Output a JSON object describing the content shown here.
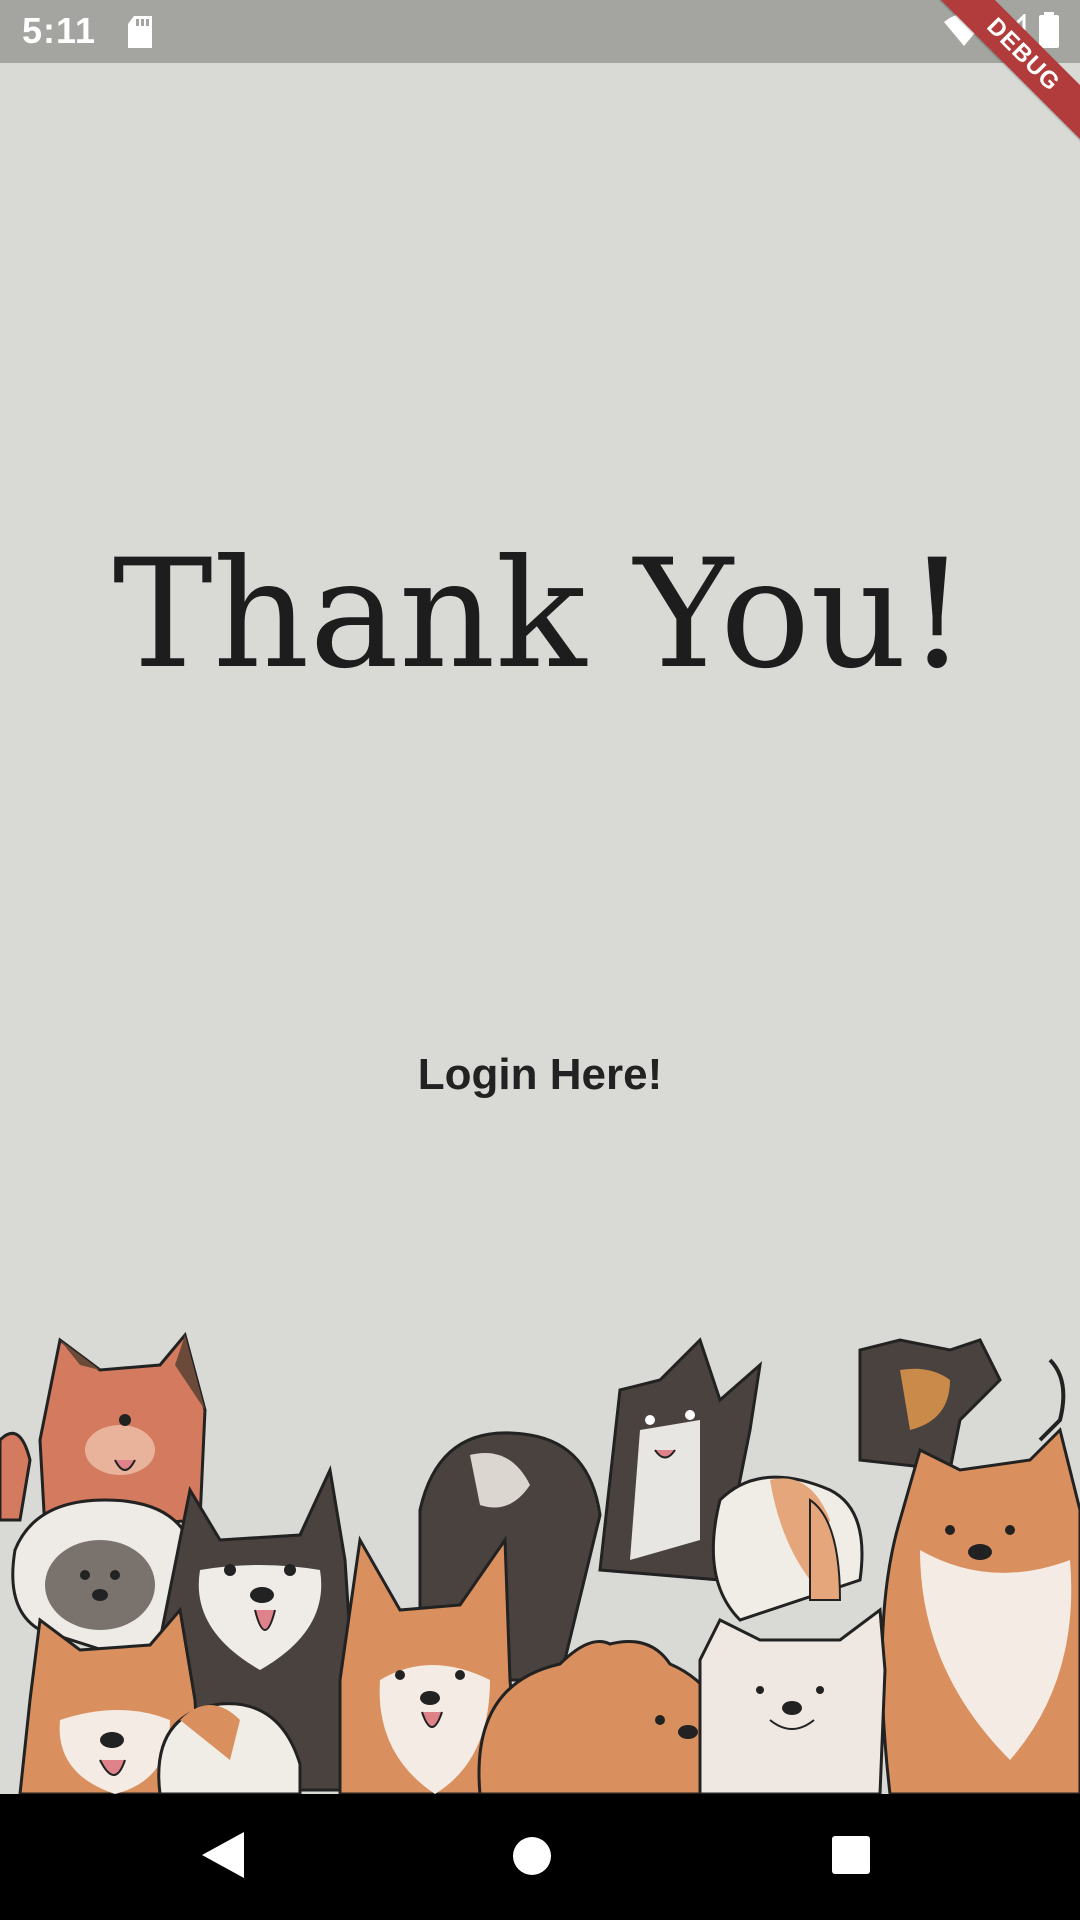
{
  "status_bar": {
    "time": "5:11",
    "icons": [
      "sd-card-icon",
      "wifi-icon",
      "cell-signal-icon",
      "battery-icon"
    ]
  },
  "debug_banner": {
    "label": "DEBUG",
    "color": "#b23b3b"
  },
  "main": {
    "title": "Thank You!",
    "login_link": "Login Here!"
  },
  "illustration": {
    "subject": "dogs-illustration"
  },
  "nav_bar": {
    "icons": [
      "back-icon",
      "home-icon",
      "recents-icon"
    ]
  },
  "colors": {
    "background": "#d9d9d6",
    "status_bar": "#a4a4a0",
    "nav_bar": "#000000",
    "text": "#1d1d1d"
  }
}
